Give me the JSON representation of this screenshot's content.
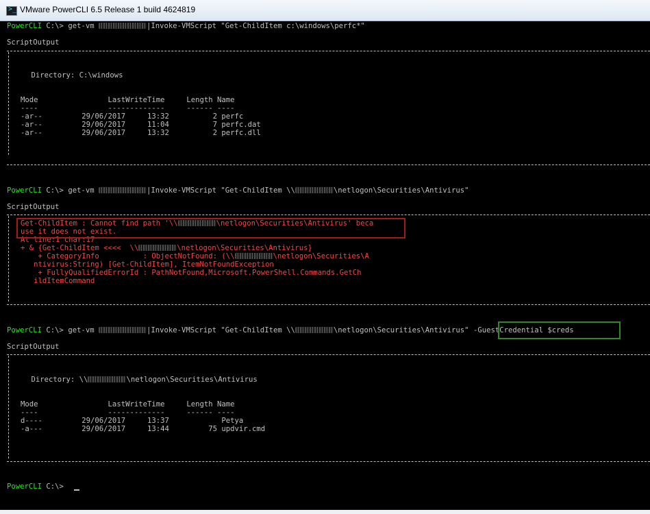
{
  "window": {
    "title": "VMware PowerCLI 6.5 Release 1 build 4624819",
    "icon": "powercli-icon"
  },
  "console": {
    "prompt": "PowerCLI",
    "path": "C:\\>",
    "cmd1": {
      "pre": "get-vm ",
      "post": "|Invoke-VMScript \"Get-ChildItem c:\\windows\\perfc*\""
    },
    "cmd2": {
      "pre": "get-vm ",
      "mid": "|Invoke-VMScript \"Get-ChildItem \\\\",
      "post": "\\netlogon\\Securities\\Antivirus\""
    },
    "cmd3": {
      "pre": "get-vm ",
      "mid": "|Invoke-VMScript \"Get-ChildItem \\\\",
      "post": "\\netlogon\\Securities\\Antivirus\" ",
      "highlight": "-GuestCredential $creds"
    },
    "script_output": "ScriptOutput",
    "out1": {
      "directory": "    Directory: C:\\windows",
      "header": "Mode                LastWriteTime     Length Name",
      "underline": "----                -------------     ------ ----",
      "rows": [
        "-ar--         29/06/2017     13:32          2 perfc",
        "-ar--         29/06/2017     11:04          7 perfc.dat",
        "-ar--         29/06/2017     13:32          2 perfc.dll"
      ]
    },
    "out2": {
      "err1_pre": "Get-ChildItem : Cannot find path '\\\\",
      "err1_post": "\\netlogon\\Securities\\Antivirus' beca",
      "err2": "use it does not exist.",
      "err3": "At line:1 char:17",
      "err4_pre": "+ & {Get-ChildItem <<<<  \\\\",
      "err4_post": "\\netlogon\\Securities\\Antivirus}",
      "err5_pre": "    + CategoryInfo          : ObjectNotFound: (\\\\",
      "err5_post": "\\netlogon\\Securities\\A",
      "err6": "   ntivirus:String) [Get-ChildItem], ItemNotFoundException",
      "err7": "    + FullyQualifiedErrorId : PathNotFound,Microsoft.PowerShell.Commands.GetCh",
      "err8": "   ildItemCommand"
    },
    "out3": {
      "directory_pre": "    Directory: \\\\",
      "directory_post": "\\netlogon\\Securities\\Antivirus",
      "header": "Mode                LastWriteTime     Length Name",
      "underline": "----                -------------     ------ ----",
      "rows": [
        "d----         29/06/2017     13:37            Petya",
        "-a---         29/06/2017     13:44         75 updvir.cmd"
      ]
    }
  },
  "colors": {
    "prompt": "#00ff00",
    "text": "#c0c0c0",
    "error": "#ff4040",
    "red_highlight": "#a31d1d",
    "green_highlight": "#2e8b1e",
    "background": "#000000"
  }
}
